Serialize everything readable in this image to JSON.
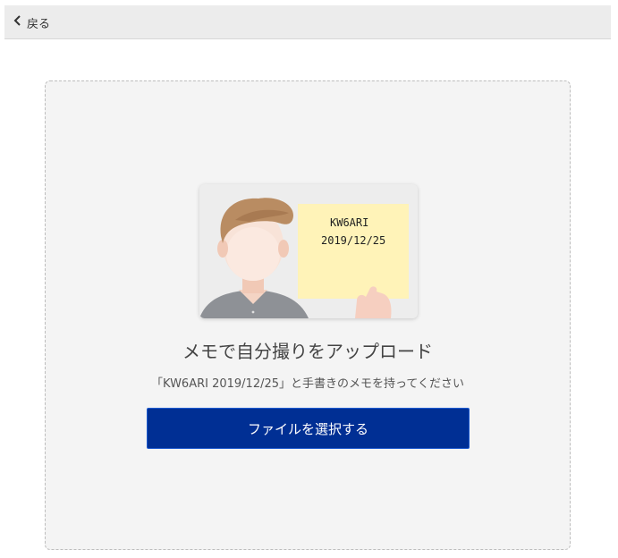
{
  "nav": {
    "back_label": "戻る"
  },
  "upload": {
    "memo_line1": "KW6ARI",
    "memo_line2": "2019/12/25",
    "heading": "メモで自分撮りをアップロード",
    "instruction": "「KW6ARI 2019/12/25」と手書きのメモを持ってください",
    "select_button_label": "ファイルを選択する"
  },
  "colors": {
    "accent_button": "#002f94",
    "memo_paper": "#fff3b8",
    "upload_zone_bg": "#f4f4f4"
  },
  "icons": {
    "back": "chevron-left-icon"
  }
}
